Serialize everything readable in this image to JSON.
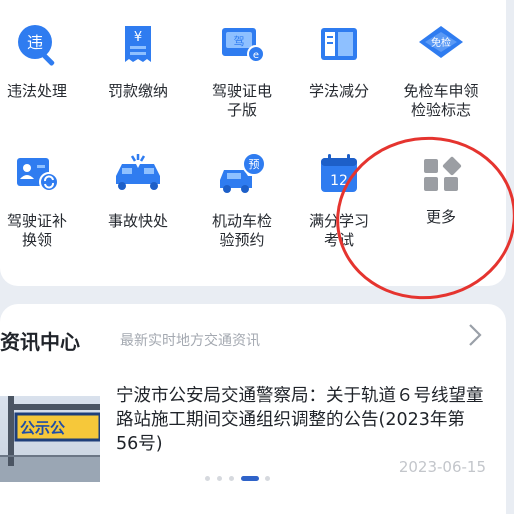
{
  "services": [
    {
      "id": "violation",
      "icon": "violation-icon",
      "label": "违法处理"
    },
    {
      "id": "fine",
      "icon": "fine-receipt-icon",
      "label": "罚款缴纳"
    },
    {
      "id": "e-license",
      "icon": "electronic-license-icon",
      "label": "驾驶证电\n子版"
    },
    {
      "id": "study",
      "icon": "study-book-icon",
      "label": "学法减分"
    },
    {
      "id": "exempt-inspection",
      "icon": "exempt-inspection-badge-icon",
      "label": "免检车申领\n检验标志"
    },
    {
      "id": "license-renew",
      "icon": "license-renew-icon",
      "label": "驾驶证补\n换领"
    },
    {
      "id": "accident",
      "icon": "accident-cars-icon",
      "label": "事故快处"
    },
    {
      "id": "vehicle-inspection",
      "icon": "inspection-booking-icon",
      "label": "机动车检\n验预约"
    },
    {
      "id": "full-score",
      "icon": "calendar-12-icon",
      "label": "满分学习\n考试"
    },
    {
      "id": "more",
      "icon": "more-grid-icon",
      "label": "更多"
    }
  ],
  "icon_text": {
    "violation": "违",
    "fine": "¥",
    "e-license": "驾",
    "exempt": "免检",
    "booking": "预",
    "calendar": "12"
  },
  "news": {
    "title": "资讯中心",
    "subtitle": "最新实时地方交通资讯",
    "headline": "宁波市公安局交通警察局：关于轨道６号线望童路站施工期间交通组织调整的公告(2023年第56号)",
    "date": "2023-06-15",
    "thumb_sign": "公示公",
    "carousel": {
      "count": 5,
      "active_index": 3
    }
  },
  "colors": {
    "brand_blue": "#2f7cf0",
    "light_blue": "#8ec0ff",
    "annotation_red": "#e5342f",
    "more_grey": "#9b9ea3"
  }
}
